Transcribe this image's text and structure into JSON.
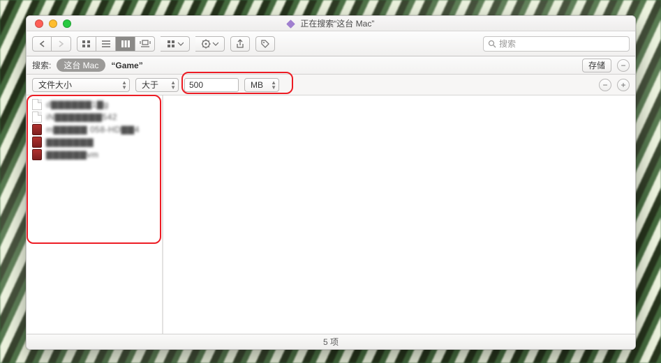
{
  "window": {
    "title": "正在搜索“这台 Mac”"
  },
  "search": {
    "placeholder": "搜索",
    "label": "搜索:",
    "scope_pill": "这台 Mac",
    "context": "“Game”",
    "save_label": "存储"
  },
  "criteria": {
    "attribute": "文件大小",
    "operator": "大于",
    "value": "500",
    "unit": "MB"
  },
  "results": {
    "items": [
      {
        "icon": "doc",
        "name": "d▇▇▇▇▇▇1▇g"
      },
      {
        "icon": "doc",
        "name": "iN▇▇▇▇▇▇▇542"
      },
      {
        "icon": "app",
        "name": "m▇▇▇▇▇ 058-HD▇▇4"
      },
      {
        "icon": "app",
        "name": "▇▇▇▇▇▇▇"
      },
      {
        "icon": "app",
        "name": "▇▇▇▇▇▇vm"
      }
    ]
  },
  "status": {
    "text": "5 项"
  },
  "icons": {
    "minus": "−",
    "plus": "+"
  }
}
